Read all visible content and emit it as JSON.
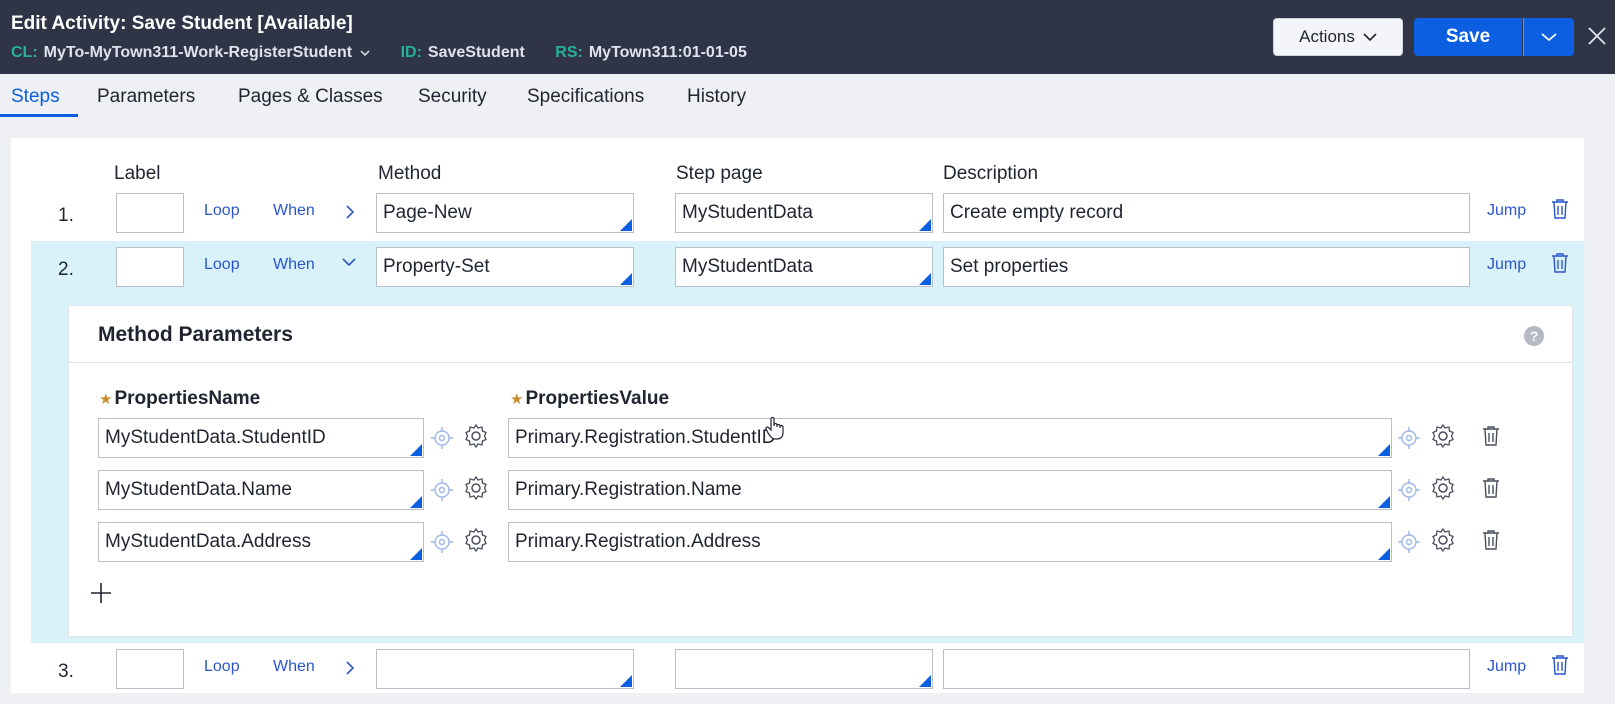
{
  "header": {
    "title": "Edit  Activity: Save Student [Available]",
    "cl_label": "CL:",
    "cl_value": "MyTo-MyTown311-Work-RegisterStudent",
    "id_label": "ID:",
    "id_value": "SaveStudent",
    "rs_label": "RS:",
    "rs_value": "MyTown311:01-01-05",
    "actions_label": "Actions",
    "save_label": "Save"
  },
  "tabs": [
    {
      "label": "Steps",
      "active": true
    },
    {
      "label": "Parameters"
    },
    {
      "label": "Pages & Classes"
    },
    {
      "label": "Security"
    },
    {
      "label": "Specifications"
    },
    {
      "label": "History"
    }
  ],
  "columns": {
    "label": "Label",
    "method": "Method",
    "step_page": "Step page",
    "description": "Description"
  },
  "steps": [
    {
      "num": "1.",
      "loop": "Loop",
      "when": "When",
      "method": "Page-New",
      "step_page": "MyStudentData",
      "description": "Create empty record",
      "jump": "Jump"
    },
    {
      "num": "2.",
      "loop": "Loop",
      "when": "When",
      "method": "Property-Set",
      "step_page": "MyStudentData",
      "description": "Set properties",
      "jump": "Jump"
    },
    {
      "num": "3.",
      "loop": "Loop",
      "when": "When",
      "method": "",
      "step_page": "",
      "description": "",
      "jump": "Jump"
    }
  ],
  "method_parameters": {
    "title": "Method Parameters",
    "name_header": "PropertiesName",
    "value_header": "PropertiesValue",
    "rows": [
      {
        "name": "MyStudentData.StudentID",
        "value": "Primary.Registration.StudentID"
      },
      {
        "name": "MyStudentData.Name",
        "value": "Primary.Registration.Name"
      },
      {
        "name": "MyStudentData.Address",
        "value": "Primary.Registration.Address"
      }
    ]
  },
  "colors": {
    "header_bg": "#2f3447",
    "accent": "#0b5fe0",
    "meta_label": "#26b29a",
    "highlight_row": "#d9f1f8",
    "link": "#2a56c9"
  }
}
